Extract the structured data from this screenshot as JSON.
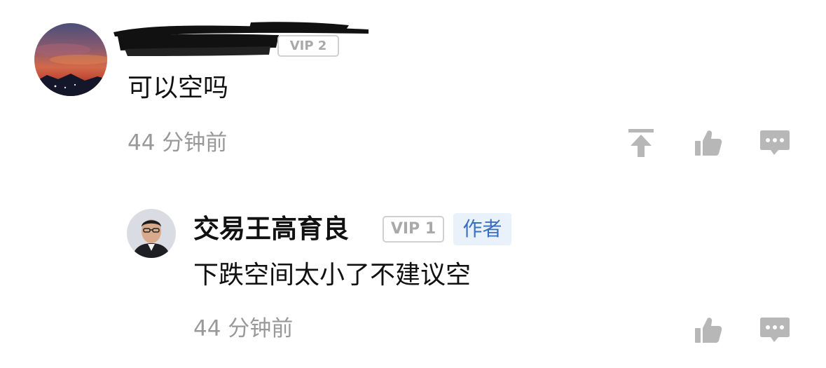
{
  "comment": {
    "content": "可以空吗",
    "time": "44 分钟前",
    "vip_badge": "VIP 2",
    "actions": {
      "pin_icon": "pin-to-top-icon",
      "like_icon": "thumbs-up-icon",
      "reply_icon": "comment-icon"
    }
  },
  "reply": {
    "username": "交易王高育良",
    "vip_badge": "VIP 1",
    "author_label": "作者",
    "content": "下跌空间太小了不建议空",
    "time": "44 分钟前",
    "actions": {
      "like_icon": "thumbs-up-icon",
      "reply_icon": "comment-icon"
    }
  },
  "colors": {
    "secondary_text": "#999999",
    "icon_gray": "#b7b7b7",
    "author_badge_bg": "#e9f1fb",
    "author_badge_text": "#3a6fc0"
  }
}
